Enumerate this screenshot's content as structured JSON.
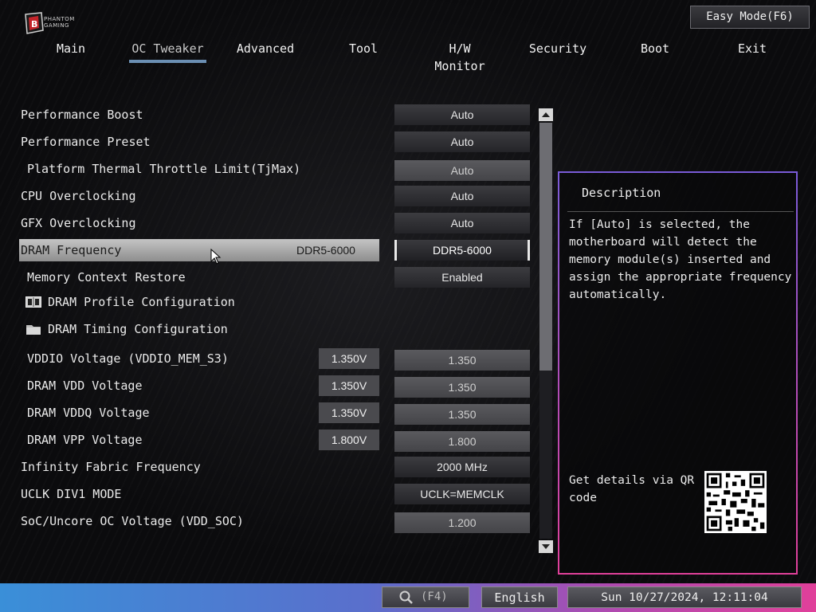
{
  "header": {
    "logo_line1": "PHANTOM",
    "logo_line2": "GAMING",
    "easy_mode_label": "Easy Mode(F6)"
  },
  "nav": {
    "tabs": [
      {
        "label": "Main"
      },
      {
        "label": "OC Tweaker"
      },
      {
        "label": "Advanced"
      },
      {
        "label": "Tool"
      },
      {
        "label": "H/W Monitor"
      },
      {
        "label": "Security"
      },
      {
        "label": "Boot"
      },
      {
        "label": "Exit"
      }
    ],
    "active": "OC Tweaker"
  },
  "settings": {
    "performance_boost": {
      "label": "Performance Boost",
      "value": "Auto"
    },
    "performance_preset": {
      "label": "Performance Preset",
      "value": "Auto"
    },
    "thermal_limit": {
      "label": "Platform Thermal Throttle Limit(TjMax)",
      "value": "Auto"
    },
    "cpu_oc": {
      "label": "CPU Overclocking",
      "value": "Auto"
    },
    "gfx_oc": {
      "label": "GFX Overclocking",
      "value": "Auto"
    },
    "dram_freq": {
      "label": "DRAM Frequency",
      "current": "DDR5-6000",
      "value": "DDR5-6000"
    },
    "memory_context": {
      "label": "Memory Context Restore",
      "value": "Enabled"
    },
    "dram_profile": {
      "label": "DRAM Profile Configuration"
    },
    "dram_timing": {
      "label": "DRAM Timing Configuration"
    },
    "vddio": {
      "label": "VDDIO Voltage (VDDIO_MEM_S3)",
      "current": "1.350V",
      "value": "1.350"
    },
    "dram_vdd": {
      "label": "DRAM VDD Voltage",
      "current": "1.350V",
      "value": "1.350"
    },
    "dram_vddq": {
      "label": "DRAM VDDQ Voltage",
      "current": "1.350V",
      "value": "1.350"
    },
    "dram_vpp": {
      "label": "DRAM VPP Voltage",
      "current": "1.800V",
      "value": "1.800"
    },
    "infinity_fabric": {
      "label": "Infinity Fabric Frequency",
      "value": "2000 MHz"
    },
    "uclk": {
      "label": "UCLK DIV1 MODE",
      "value": "UCLK=MEMCLK"
    },
    "soc_voltage": {
      "label": "SoC/Uncore OC Voltage (VDD_SOC)",
      "value": "1.200"
    }
  },
  "description": {
    "title": "Description",
    "text": "If [Auto] is selected, the motherboard will detect the memory module(s) inserted and assign the appropriate frequency automatically.",
    "qr_text": "Get details via QR code"
  },
  "footer": {
    "search_label": "(F4)",
    "language": "English",
    "datetime": "Sun 10/27/2024, 12:11:04"
  },
  "scrollbar": {
    "position_fraction": 0.0,
    "visible_fraction": 0.6
  },
  "colors": {
    "accent_tab": "#6b8fb3",
    "desc_border_top": "#7a5bd8",
    "desc_border_bottom": "#e0409a",
    "footer_left": "#3a8fd8",
    "footer_right": "#e0409a"
  }
}
